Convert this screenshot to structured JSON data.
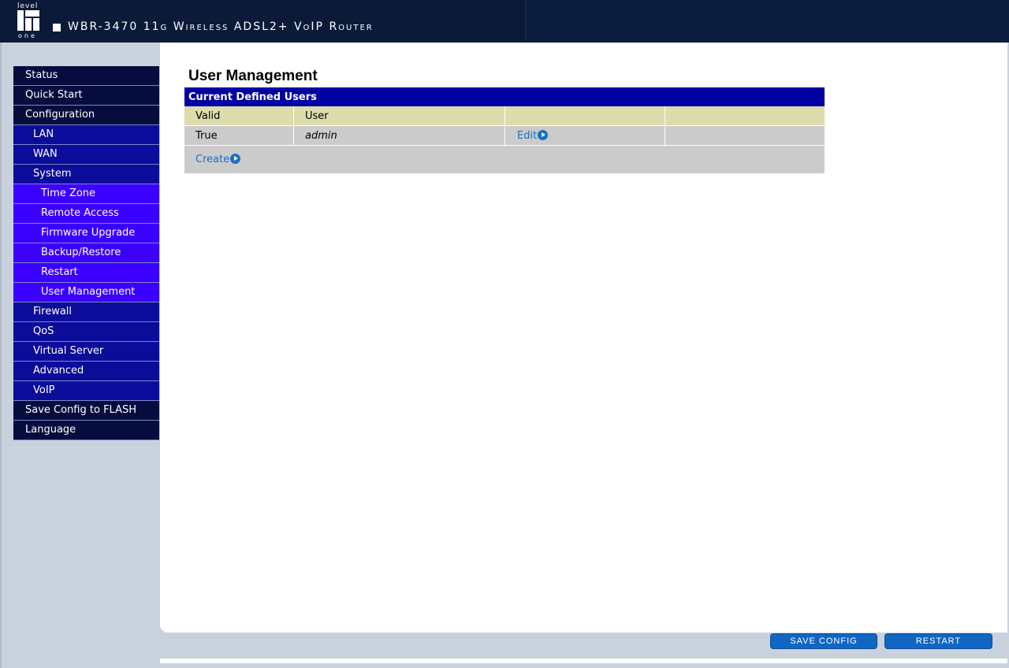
{
  "header": {
    "logo_top": "level",
    "logo_bottom": "one",
    "title": "WBR-3470 11g Wireless ADSL2+ VoIP Router"
  },
  "sidebar": {
    "items": [
      {
        "label": "Status",
        "level": 0
      },
      {
        "label": "Quick Start",
        "level": 0
      },
      {
        "label": "Configuration",
        "level": 0
      },
      {
        "label": "LAN",
        "level": 1
      },
      {
        "label": "WAN",
        "level": 1
      },
      {
        "label": "System",
        "level": 1
      },
      {
        "label": "Time Zone",
        "level": 2
      },
      {
        "label": "Remote Access",
        "level": 2
      },
      {
        "label": "Firmware Upgrade",
        "level": 2
      },
      {
        "label": "Backup/Restore",
        "level": 2
      },
      {
        "label": "Restart",
        "level": 2
      },
      {
        "label": "User Management",
        "level": 2,
        "selected": true
      },
      {
        "label": "Firewall",
        "level": 1
      },
      {
        "label": "QoS",
        "level": 1
      },
      {
        "label": "Virtual Server",
        "level": 1
      },
      {
        "label": "Advanced",
        "level": 1
      },
      {
        "label": "VoIP",
        "level": 1
      },
      {
        "label": "Save Config to FLASH",
        "level": 0
      },
      {
        "label": "Language",
        "level": 0
      }
    ]
  },
  "main": {
    "title": "User Management",
    "table": {
      "caption": "Current Defined Users",
      "headers": [
        "Valid",
        "User"
      ],
      "rows": [
        {
          "valid": "True",
          "user": "admin",
          "action": "Edit"
        }
      ],
      "create_label": "Create"
    }
  },
  "footer": {
    "save_config": "SAVE CONFIG",
    "restart": "RESTART"
  },
  "colors": {
    "header_bg": "#0b1d3e",
    "nav_level0": "#060d3e",
    "nav_level1": "#0c0c9a",
    "nav_level2": "#3b00ff",
    "table_caption": "#0000a3",
    "table_header": "#dcdcac",
    "table_row": "#cbcbcb",
    "link": "#1a6fc4",
    "button": "#1166c4"
  }
}
